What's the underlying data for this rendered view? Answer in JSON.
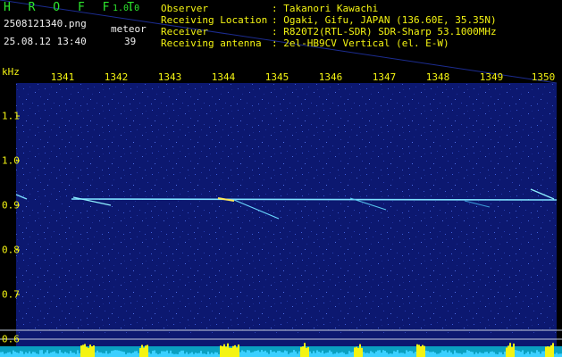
{
  "header": {
    "app_name": "H R O F F T",
    "app_version": "1.0.0",
    "file_name": "2508121340.png",
    "datetime": "25.08.12 13:40",
    "meteor_label": "meteor",
    "meteor_count": "39"
  },
  "info": [
    {
      "key": "Observer",
      "value": ": Takanori Kawachi"
    },
    {
      "key": "Receiving Location",
      "value": ": Ogaki, Gifu, JAPAN (136.60E, 35.35N)"
    },
    {
      "key": "Receiver",
      "value": ": R820T2(RTL-SDR) SDR-Sharp 53.1000MHz"
    },
    {
      "key": "Receiving antenna",
      "value": ": 2el-HB9CV Vertical (el. E-W)"
    }
  ],
  "axis": {
    "y_unit": "kHz",
    "x_ticks": [
      "1341",
      "1342",
      "1343",
      "1344",
      "1345",
      "1346",
      "1347",
      "1348",
      "1349",
      "1350"
    ],
    "y_ticks": [
      "1.1",
      "1.0",
      "0.9",
      "0.8",
      "0.7",
      "0.6"
    ]
  },
  "colors": {
    "background": "#000000",
    "plot": "#0c1870",
    "label": "#f4f412",
    "brand": "#2ee82e",
    "trace": "#7ee0ff",
    "meteor": "#ffe85a"
  }
}
